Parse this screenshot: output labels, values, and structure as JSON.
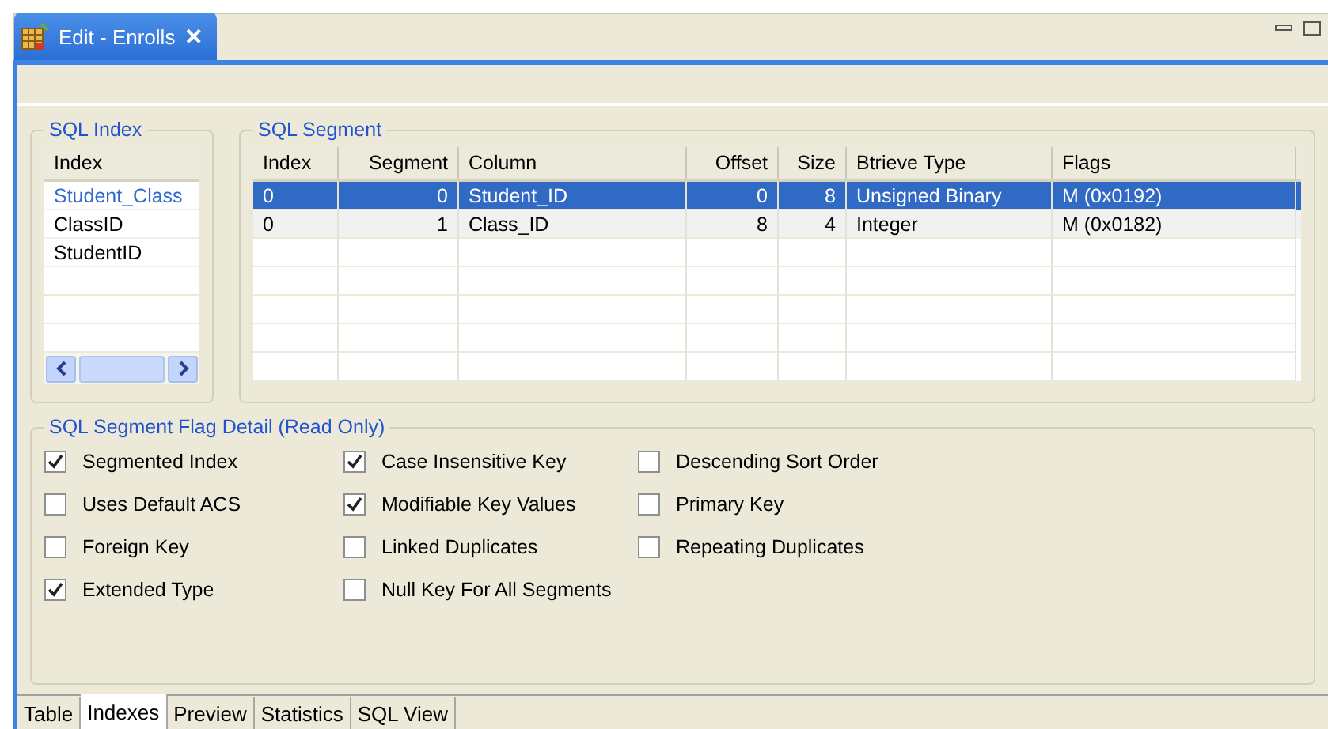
{
  "editor_tab": {
    "title": "Edit - Enrolls",
    "close": "✕"
  },
  "sql_index": {
    "title": "SQL Index",
    "column": "Index",
    "items": [
      {
        "name": "Student_Class",
        "selected": true
      },
      {
        "name": "ClassID",
        "selected": false
      },
      {
        "name": "StudentID",
        "selected": false
      }
    ]
  },
  "sql_segment": {
    "title": "SQL Segment",
    "columns": [
      "Index",
      "Segment",
      "Column",
      "Offset",
      "Size",
      "Btrieve Type",
      "Flags"
    ],
    "rows": [
      {
        "cells": [
          "0",
          "0",
          "Student_ID",
          "0",
          "8",
          "Unsigned Binary",
          "M  (0x0192)"
        ],
        "selected": true
      },
      {
        "cells": [
          "0",
          "1",
          "Class_ID",
          "8",
          "4",
          "Integer",
          "M  (0x0182)"
        ],
        "selected": false
      }
    ]
  },
  "flag_detail": {
    "title": "SQL Segment Flag Detail  (Read Only)",
    "columns": [
      [
        {
          "label": "Segmented Index",
          "checked": true
        },
        {
          "label": "Uses Default ACS",
          "checked": false
        },
        {
          "label": "Foreign Key",
          "checked": false
        },
        {
          "label": "Extended Type",
          "checked": true
        }
      ],
      [
        {
          "label": "Case Insensitive Key",
          "checked": true
        },
        {
          "label": "Modifiable Key Values",
          "checked": true
        },
        {
          "label": "Linked Duplicates",
          "checked": false
        },
        {
          "label": "Null Key For All Segments",
          "checked": false
        }
      ],
      [
        {
          "label": "Descending Sort Order",
          "checked": false
        },
        {
          "label": "Primary Key",
          "checked": false
        },
        {
          "label": "Repeating Duplicates",
          "checked": false
        }
      ]
    ]
  },
  "bottom_tabs": [
    {
      "label": "Table",
      "selected": false
    },
    {
      "label": "Indexes",
      "selected": true
    },
    {
      "label": "Preview",
      "selected": false
    },
    {
      "label": "Statistics",
      "selected": false
    },
    {
      "label": "SQL View",
      "selected": false
    }
  ]
}
